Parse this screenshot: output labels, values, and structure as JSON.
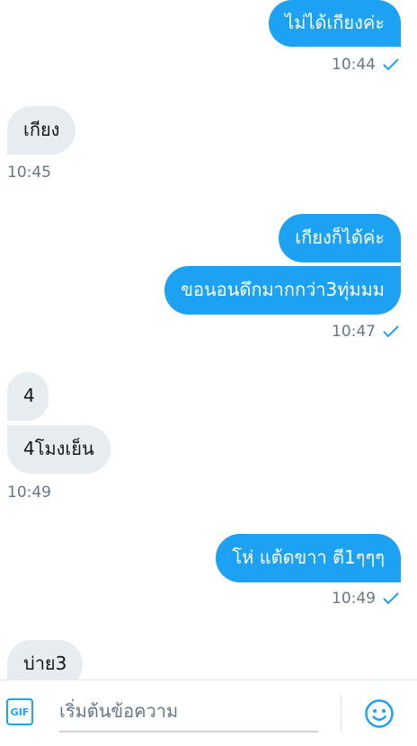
{
  "messages": [
    {
      "text": "ไม่ได้เกียงค่ะ"
    },
    {
      "text": "เกียง"
    },
    {
      "text": "เกียงก็ได้ค่ะ"
    },
    {
      "text": "ขอนอนดึกมากกว่า3ทุ่มมม"
    },
    {
      "text": "4"
    },
    {
      "text": "4โมงเย็น"
    },
    {
      "text": "โห่ แต้ดขาา ตี1ๆๆๆ"
    },
    {
      "text": "บ่าย3"
    }
  ],
  "timestamps": [
    "10:44",
    "10:45",
    "10:47",
    "10:49",
    "10:49"
  ],
  "composer": {
    "gif_label": "GIF",
    "placeholder": "เริ่มต้นข้อความ"
  },
  "icons": {
    "sent": "check-icon",
    "gif": "gif-icon",
    "emoji": "emoji-icon"
  },
  "colors": {
    "accent": "#1da1f2",
    "incoming_bubble": "#e6ecf0",
    "timestamp": "#657786"
  }
}
